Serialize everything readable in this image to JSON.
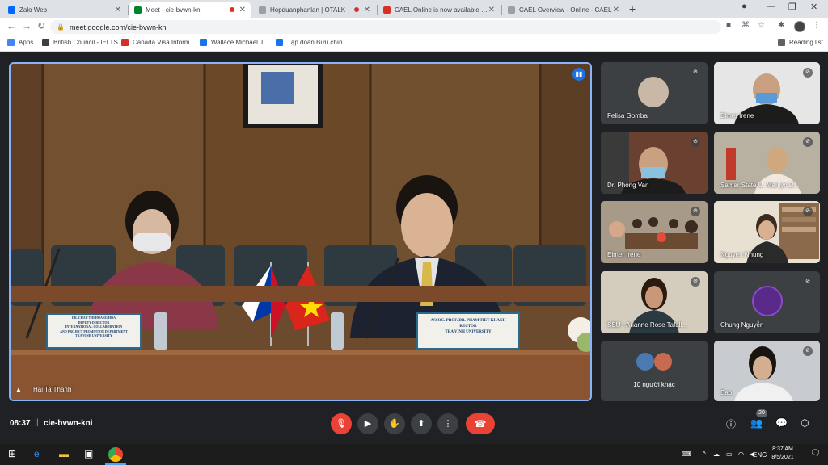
{
  "tabs": [
    {
      "title": "Zalo Web",
      "favicon_color": "#0068ff",
      "recording": false,
      "active": false
    },
    {
      "title": "Meet - cie-bvwn-kni",
      "favicon_color": "#00832d",
      "recording": true,
      "active": true
    },
    {
      "title": "Hopduanphanlan | OTALK",
      "favicon_color": "#e8e8e8",
      "recording": true,
      "active": false
    },
    {
      "title": "CAEL Online is now available in V",
      "favicon_color": "#d93025",
      "recording": false,
      "active": false
    },
    {
      "title": "CAEL Overview - Online - CAEL",
      "favicon_color": "#9aa0a6",
      "recording": false,
      "active": false
    }
  ],
  "address_bar": {
    "url": "meet.google.com/cie-bvwn-kni"
  },
  "bookmarks": [
    {
      "label": "Apps",
      "icon_color": "#4285f4"
    },
    {
      "label": "British Council - IELTS",
      "icon_color": "#3c4043"
    },
    {
      "label": "Canada Visa Inform...",
      "icon_color": "#d93025"
    },
    {
      "label": "Wallace Michael J...",
      "icon_color": "#1a73e8"
    },
    {
      "label": "Tập đoàn Bưu chín...",
      "icon_color": "#1a73e8"
    }
  ],
  "reading_list": "Reading list",
  "main_speaker": {
    "name": "Hai Ta Thanh",
    "placard_left": [
      "DR. CHAU THI HOANG HOA",
      "DEPUTY DIRECTOR",
      "INTERNATIONAL COLLABORATION",
      "AND PROJECT PROMOTION DEPARTMENT",
      "TRA VINH UNIVERSITY"
    ],
    "placard_right": [
      "ASSOC. PROF. DR. PHAM TIET KHANH",
      "RECTOR",
      "TRA VINH UNIVERSITY"
    ]
  },
  "participants": [
    {
      "name": "Felisa Gomba",
      "muted": true,
      "bg": "#4a4a4a"
    },
    {
      "name": "Elmer Irene",
      "muted": true,
      "bg": "#e6e6e6"
    },
    {
      "name": "Dr. Phong Van",
      "muted": true,
      "bg": "#5a3a2a"
    },
    {
      "name": "Samar State U. Marilyn D...",
      "muted": true,
      "bg": "#8a8070"
    },
    {
      "name": "Elmer Irene",
      "muted": true,
      "bg": "#a89a88"
    },
    {
      "name": "Nguyen Nhung",
      "muted": true,
      "bg": "#d8d0c0"
    },
    {
      "name": "SSU - Arianne Rose Tafall...",
      "muted": true,
      "bg": "#c0b8a8"
    },
    {
      "name": "Chung Nguyễn",
      "muted": true,
      "bg": "#3c4043"
    },
    {
      "name": "10 người khác",
      "muted": false,
      "bg": "#3c4043"
    },
    {
      "name": "Bao",
      "muted": true,
      "bg": "#d0d4d8"
    }
  ],
  "meeting": {
    "time": "08:37",
    "separator": "|",
    "code": "cie-bvwn-kni",
    "participant_count": "20"
  },
  "taskbar": {
    "clock_time": "8:37 AM",
    "clock_date": "8/5/2021",
    "lang": "ENG"
  }
}
